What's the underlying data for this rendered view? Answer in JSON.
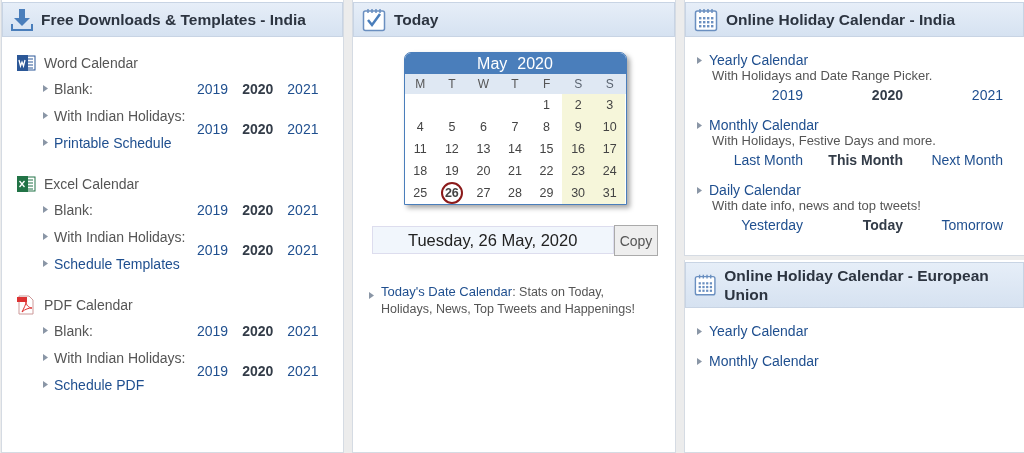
{
  "downloads": {
    "title": "Free Downloads & Templates - India",
    "groups": [
      {
        "kind": "word",
        "title": "Word Calendar",
        "entries": [
          {
            "items": [
              {
                "label": "Blank:",
                "link": false
              }
            ],
            "years": [
              {
                "label": "2019",
                "selected": false
              },
              {
                "label": "2020",
                "selected": true
              },
              {
                "label": "2021",
                "selected": false
              }
            ]
          },
          {
            "items": [
              {
                "label": "With Indian Holidays:",
                "link": false
              },
              {
                "label": "Printable Schedule",
                "link": true
              }
            ],
            "years": [
              {
                "label": "2019",
                "selected": false
              },
              {
                "label": "2020",
                "selected": true
              },
              {
                "label": "2021",
                "selected": false
              }
            ]
          }
        ]
      },
      {
        "kind": "excel",
        "title": "Excel Calendar",
        "entries": [
          {
            "items": [
              {
                "label": "Blank:",
                "link": false
              }
            ],
            "years": [
              {
                "label": "2019",
                "selected": false
              },
              {
                "label": "2020",
                "selected": true
              },
              {
                "label": "2021",
                "selected": false
              }
            ]
          },
          {
            "items": [
              {
                "label": "With Indian Holidays:",
                "link": false
              },
              {
                "label": "Schedule Templates",
                "link": true
              }
            ],
            "years": [
              {
                "label": "2019",
                "selected": false
              },
              {
                "label": "2020",
                "selected": true
              },
              {
                "label": "2021",
                "selected": false
              }
            ]
          }
        ]
      },
      {
        "kind": "pdf",
        "title": "PDF Calendar",
        "entries": [
          {
            "items": [
              {
                "label": "Blank:",
                "link": false
              }
            ],
            "years": [
              {
                "label": "2019",
                "selected": false
              },
              {
                "label": "2020",
                "selected": true
              },
              {
                "label": "2021",
                "selected": false
              }
            ]
          },
          {
            "items": [
              {
                "label": "With Indian Holidays:",
                "link": false
              },
              {
                "label": "Schedule PDF",
                "link": true
              }
            ],
            "years": [
              {
                "label": "2019",
                "selected": false
              },
              {
                "label": "2020",
                "selected": true
              },
              {
                "label": "2021",
                "selected": false
              }
            ]
          }
        ]
      }
    ]
  },
  "today": {
    "title": "Today",
    "calendar": {
      "month": "May",
      "year": "2020",
      "weekdays": [
        {
          "label": "M",
          "weekend": false
        },
        {
          "label": "T",
          "weekend": false
        },
        {
          "label": "W",
          "weekend": false
        },
        {
          "label": "T",
          "weekend": false
        },
        {
          "label": "F",
          "weekend": false
        },
        {
          "label": "S",
          "weekend": true
        },
        {
          "label": "S",
          "weekend": true
        }
      ],
      "weeks": [
        [
          {
            "day": "1",
            "selected": false
          },
          {
            "day": "2",
            "selected": false
          },
          {
            "day": "3",
            "selected": false
          }
        ],
        [
          {
            "day": "4",
            "selected": false
          },
          {
            "day": "5",
            "selected": false
          },
          {
            "day": "6",
            "selected": false
          },
          {
            "day": "7",
            "selected": false
          },
          {
            "day": "8",
            "selected": false
          },
          {
            "day": "9",
            "selected": false
          },
          {
            "day": "10",
            "selected": false
          }
        ],
        [
          {
            "day": "11",
            "selected": false
          },
          {
            "day": "12",
            "selected": false
          },
          {
            "day": "13",
            "selected": false
          },
          {
            "day": "14",
            "selected": false
          },
          {
            "day": "15",
            "selected": false
          },
          {
            "day": "16",
            "selected": false
          },
          {
            "day": "17",
            "selected": false
          }
        ],
        [
          {
            "day": "18",
            "selected": false
          },
          {
            "day": "19",
            "selected": false
          },
          {
            "day": "20",
            "selected": false
          },
          {
            "day": "21",
            "selected": false
          },
          {
            "day": "22",
            "selected": false
          },
          {
            "day": "23",
            "selected": false
          },
          {
            "day": "24",
            "selected": false
          }
        ],
        [
          {
            "day": "25",
            "selected": false
          },
          {
            "day": "26",
            "selected": true
          },
          {
            "day": "27",
            "selected": false
          },
          {
            "day": "28",
            "selected": false
          },
          {
            "day": "29",
            "selected": false
          },
          {
            "day": "30",
            "selected": false
          },
          {
            "day": "31",
            "selected": false
          }
        ]
      ]
    },
    "date_field": {
      "value": "Tuesday, 26 May, 2020"
    },
    "copy_button": "Copy",
    "note": {
      "link": "Today's Date Calendar",
      "text": ": Stats on Today, Holidays, News, Top Tweets and Happenings!"
    }
  },
  "online": [
    {
      "title": "Online Holiday Calendar - India",
      "items": [
        {
          "title": "Yearly Calendar",
          "description": "With Holidays and Date Range Picker.",
          "options": [
            {
              "label": "2019",
              "selected": false
            },
            {
              "label": "2020",
              "selected": true
            },
            {
              "label": "2021",
              "selected": false
            }
          ]
        },
        {
          "title": "Monthly Calendar",
          "description": "With Holidays, Festive Days and more.",
          "options": [
            {
              "label": "Last Month",
              "selected": false
            },
            {
              "label": "This Month",
              "selected": true
            },
            {
              "label": "Next Month",
              "selected": false
            }
          ]
        },
        {
          "title": "Daily Calendar",
          "description": "With date info, news and top tweets!",
          "options": [
            {
              "label": "Yesterday",
              "selected": false
            },
            {
              "label": "Today",
              "selected": true
            },
            {
              "label": "Tomorrow",
              "selected": false
            }
          ]
        }
      ]
    },
    {
      "title": "Online Holiday Calendar - European Union",
      "items": [
        {
          "title": "Yearly Calendar"
        },
        {
          "title": "Monthly Calendar"
        }
      ]
    }
  ]
}
